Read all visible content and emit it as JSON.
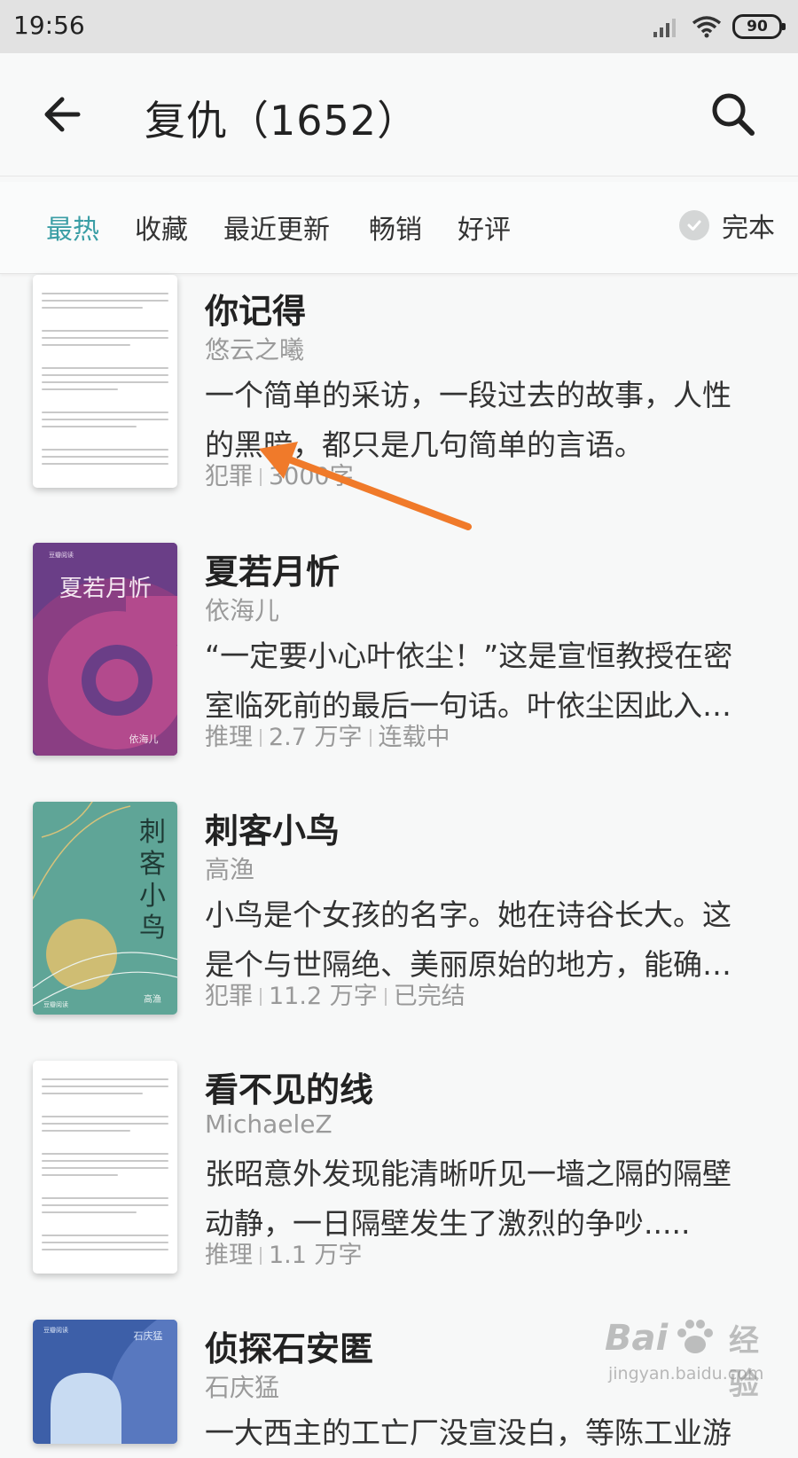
{
  "status": {
    "time": "19:56",
    "battery": "90"
  },
  "header": {
    "title": "复仇（1652）",
    "back_icon": "arrow-left-icon",
    "search_icon": "search-icon"
  },
  "filters": {
    "tabs": [
      "最热",
      "收藏",
      "最近更新",
      "畅销",
      "好评"
    ],
    "active_tab": "最热",
    "complete_label": "完本",
    "accent": "#3a9ea5"
  },
  "books": [
    {
      "title": "你记得",
      "author": "悠云之曦",
      "desc_line1": "一个简单的采访，一段过去的故事，人性",
      "desc_line2": "的黑暗，都只是几句简单的言语。",
      "genre": "犯罪",
      "words": "3000字",
      "status": ""
    },
    {
      "title": "夏若月忻",
      "author": "依海儿",
      "desc_line1": "“一定要小心叶依尘！”这是宣恒教授在密",
      "desc_line2": "室临死前的最后一句话。叶依尘因此入…",
      "genre": "推理",
      "words": "2.7 万字",
      "status": "连载中",
      "cover_title": "夏若月忻",
      "cover_author": "依海儿",
      "cover_brand": "豆瓣阅读"
    },
    {
      "title": "刺客小鸟",
      "author": "高渔",
      "desc_line1": "小鸟是个女孩的名字。她在诗谷长大。这",
      "desc_line2": "是个与世隔绝、美丽原始的地方，能确…",
      "genre": "犯罪",
      "words": "11.2 万字",
      "status": "已完结",
      "cover_title": "刺客小鸟",
      "cover_author": "高渔",
      "cover_brand": "豆瓣阅读"
    },
    {
      "title": "看不见的线",
      "author": "MichaeleZ",
      "desc_line1": "张昭意外发现能清晰听见一墙之隔的隔壁",
      "desc_line2": "动静，一日隔壁发生了激烈的争吵.....",
      "genre": "推理",
      "words": "1.1 万字",
      "status": ""
    },
    {
      "title": "侦探石安匿",
      "author": "石庆猛",
      "desc_line1": "一大西主的工亡厂没宣没白，等陈工业游",
      "desc_line2": "",
      "genre": "",
      "words": "",
      "status": "",
      "cover_author": "石庆猛",
      "cover_brand": "豆瓣阅读"
    }
  ],
  "annotation": {
    "color": "#f07a2a"
  },
  "watermark": {
    "brand": "Bai",
    "brand2": "经验",
    "url": "jingyan.baidu.com"
  }
}
